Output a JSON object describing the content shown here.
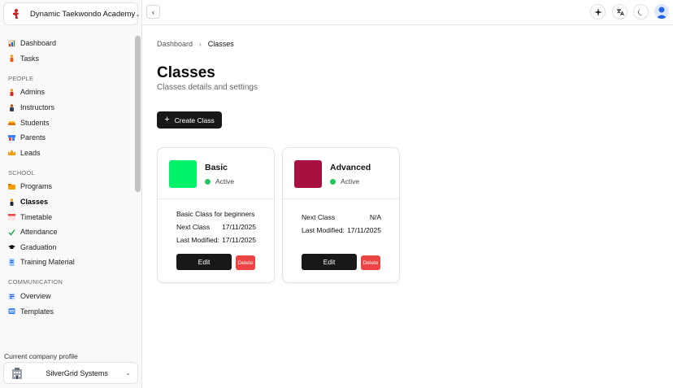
{
  "sidebar": {
    "org_name": "Dynamic Taekwondo Academy",
    "sections": {
      "people": "PEOPLE",
      "school": "SCHOOL",
      "communication": "COMMUNICATION"
    },
    "items": {
      "dashboard": "Dashboard",
      "tasks": "Tasks",
      "admins": "Admins",
      "instructors": "Instructors",
      "students": "Students",
      "parents": "Parents",
      "leads": "Leads",
      "programs": "Programs",
      "classes": "Classes",
      "timetable": "Timetable",
      "attendance": "Attendance",
      "graduation": "Graduation",
      "training_material": "Training Material",
      "overview": "Overview",
      "templates": "Templates"
    },
    "active_item": "Classes",
    "company_label": "Current company profile",
    "company_name": "SilverGrid Systems"
  },
  "header": {
    "icons": [
      "collapse-sidebar-icon",
      "sparkle-icon",
      "translate-icon",
      "moon-icon",
      "user-avatar"
    ]
  },
  "main": {
    "breadcrumb": {
      "parent": "Dashboard",
      "current": "Classes"
    },
    "title": "Classes",
    "subtitle": "Classes details and settings",
    "create_button": "Create Class",
    "cards": [
      {
        "name": "Basic",
        "status": "Active",
        "color": "#00f26a",
        "description": "Basic Class for beginners",
        "next_class_label": "Next Class",
        "next_class_value": "17/11/2025",
        "last_modified_label": "Last Modified:",
        "last_modified_value": "17/11/2025",
        "edit_label": "Edit",
        "delete_label": "Delete"
      },
      {
        "name": "Advanced",
        "status": "Active",
        "color": "#a8103f",
        "next_class_label": "Next Class",
        "next_class_value": "N/A",
        "last_modified_label": "Last Modified:",
        "last_modified_value": "17/11/2025",
        "edit_label": "Edit",
        "delete_label": "Delete"
      }
    ]
  },
  "colors": {
    "status_active": "#22c55e",
    "primary_button": "#18181b",
    "danger_button": "#ef4444"
  }
}
